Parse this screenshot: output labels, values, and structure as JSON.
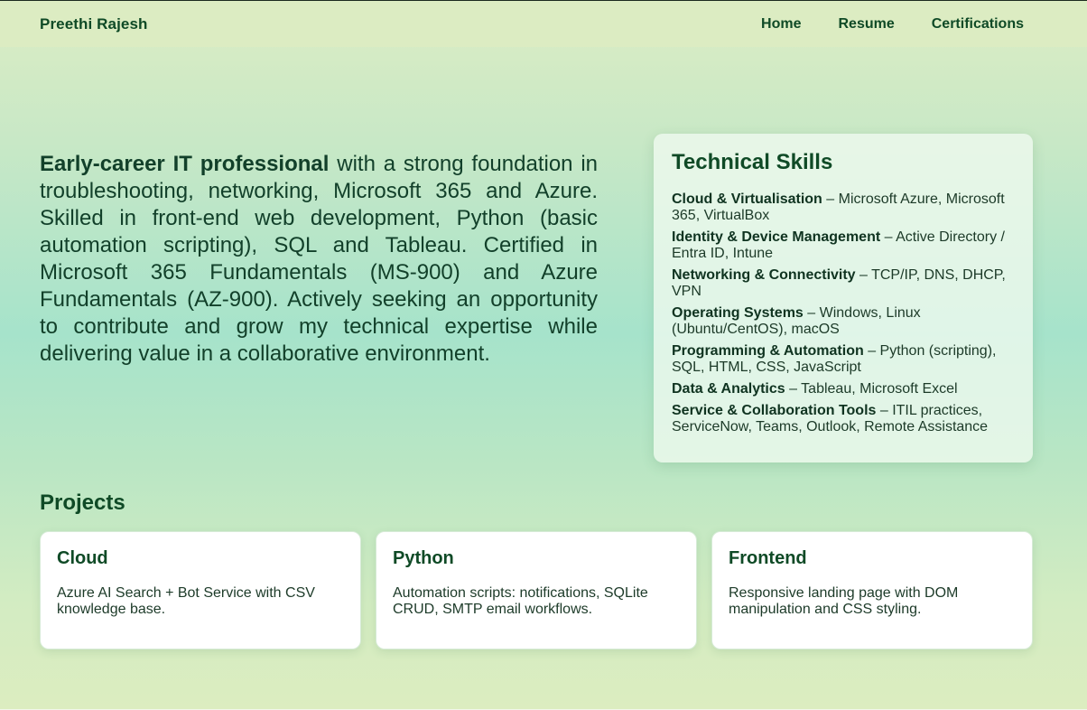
{
  "nav": {
    "brand": "Preethi Rajesh",
    "links": [
      "Home",
      "Resume",
      "Certifications"
    ]
  },
  "intro": {
    "bold": "Early-career IT professional",
    "rest": " with a strong foundation in troubleshooting, networking, Microsoft 365 and Azure. Skilled in front-end web development, Python (basic automation scripting), SQL and Tableau. Certified in Microsoft 365 Fundamentals (MS-900) and Azure Fundamentals (AZ-900). Actively seeking an opportunity to contribute and grow my technical expertise while delivering value in a collaborative environment."
  },
  "skills": {
    "title": "Technical Skills",
    "items": [
      {
        "label": "Cloud & Virtualisation",
        "text": " – Microsoft Azure, Microsoft 365, VirtualBox"
      },
      {
        "label": "Identity & Device Management",
        "text": " – Active Directory / Entra ID, Intune"
      },
      {
        "label": "Networking & Connectivity",
        "text": " – TCP/IP, DNS, DHCP, VPN"
      },
      {
        "label": "Operating Systems",
        "text": " – Windows, Linux (Ubuntu/CentOS), macOS"
      },
      {
        "label": "Programming & Automation",
        "text": " – Python (scripting), SQL, HTML, CSS, JavaScript"
      },
      {
        "label": "Data & Analytics",
        "text": " – Tableau, Microsoft Excel"
      },
      {
        "label": "Service & Collaboration Tools",
        "text": " – ITIL practices, ServiceNow, Teams, Outlook, Remote Assistance"
      }
    ]
  },
  "projects": {
    "title": "Projects",
    "cards": [
      {
        "title": "Cloud",
        "desc": "Azure AI Search + Bot Service with CSV knowledge base."
      },
      {
        "title": "Python",
        "desc": "Automation scripts: notifications, SQLite CRUD, SMTP email workflows."
      },
      {
        "title": "Frontend",
        "desc": "Responsive landing page with DOM manipulation and CSS styling."
      }
    ]
  }
}
